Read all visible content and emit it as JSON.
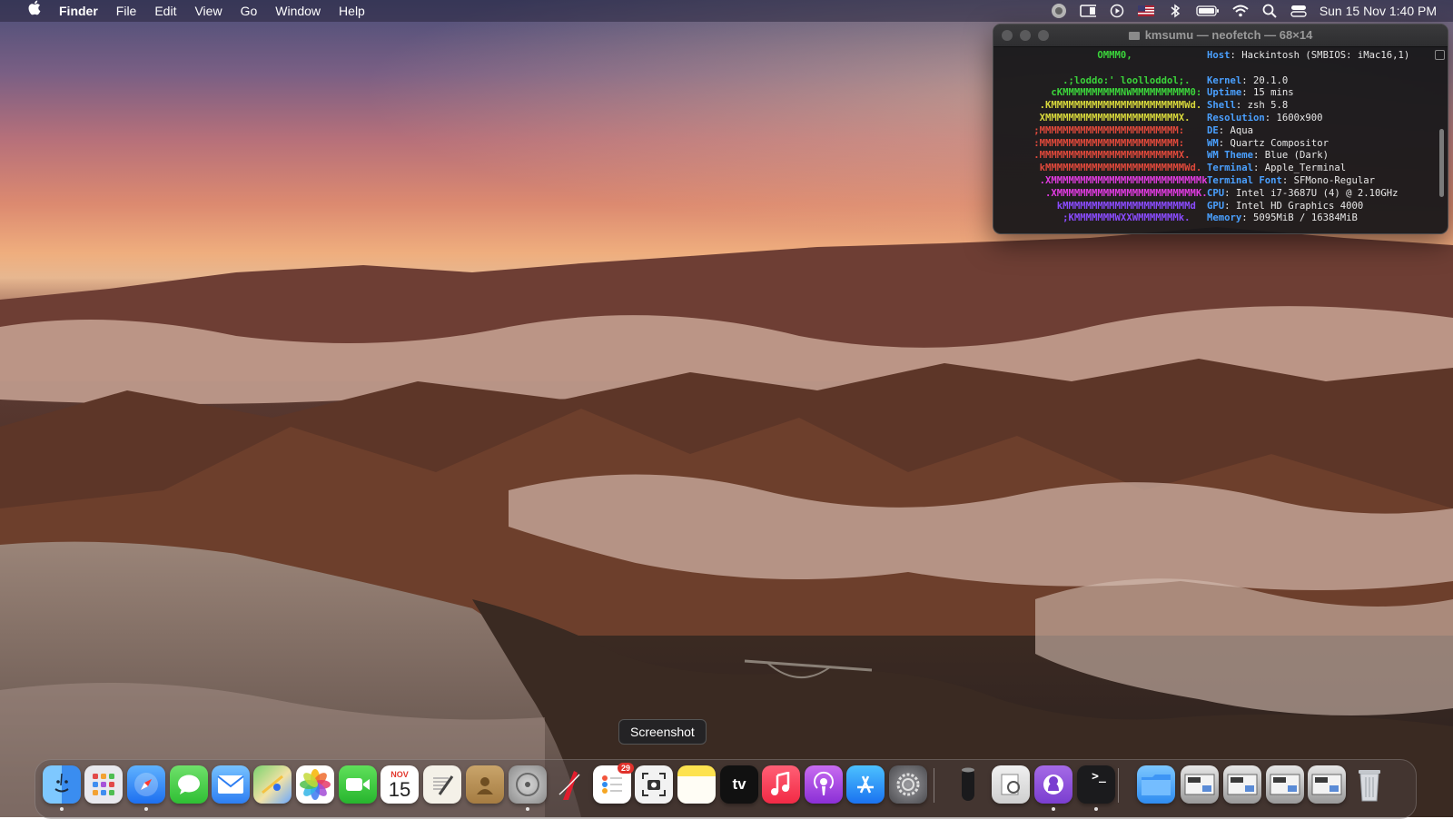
{
  "menubar": {
    "apple_icon": "apple-logo-icon",
    "app_name": "Finder",
    "menus": [
      "File",
      "Edit",
      "View",
      "Go",
      "Window",
      "Help"
    ],
    "status_icons": [
      "screen-time-icon",
      "display-icon",
      "play-icon",
      "us-flag-icon",
      "bluetooth-icon",
      "battery-icon",
      "wifi-icon",
      "spotlight-icon",
      "control-center-icon"
    ],
    "clock": "Sun 15 Nov  1:40 PM"
  },
  "terminal": {
    "title": "kmsumu — neofetch — 68×14",
    "art_lines": [
      {
        "text": "                 OMMM0,",
        "color": "#3bd43b"
      },
      {
        "text": "",
        "color": "#3bd43b"
      },
      {
        "text": "           .;loddo:' loolloddol;.",
        "color": "#3bd43b"
      },
      {
        "text": "         cKMMMMMMMMMMNWMMMMMMMMMM0:",
        "color": "#3bd43b"
      },
      {
        "text": "       .KMMMMMMMMMMMMMMMMMMMMMMMWd.",
        "color": "#d8d83c"
      },
      {
        "text": "       XMMMMMMMMMMMMMMMMMMMMMMMX.",
        "color": "#d8d83c"
      },
      {
        "text": "      ;MMMMMMMMMMMMMMMMMMMMMMMM:",
        "color": "#e0493b"
      },
      {
        "text": "      :MMMMMMMMMMMMMMMMMMMMMMMM:",
        "color": "#e0493b"
      },
      {
        "text": "      .MMMMMMMMMMMMMMMMMMMMMMMMX.",
        "color": "#e0493b"
      },
      {
        "text": "       kMMMMMMMMMMMMMMMMMMMMMMMMWd.",
        "color": "#e0493b"
      },
      {
        "text": "       .XMMMMMMMMMMMMMMMMMMMMMMMMMMk",
        "color": "#e03be0"
      },
      {
        "text": "        .XMMMMMMMMMMMMMMMMMMMMMMMMK.",
        "color": "#e03be0"
      },
      {
        "text": "          kMMMMMMMMMMMMMMMMMMMMMMd",
        "color": "#8a4bff"
      },
      {
        "text": "           ;KMMMMMMMWXXWMMMMMMMk.",
        "color": "#8a4bff"
      }
    ],
    "info": [
      {
        "key": "Host",
        "value": "Hackintosh (SMBIOS: iMac16,1)"
      },
      {
        "key": "",
        "value": ""
      },
      {
        "key": "Kernel",
        "value": "20.1.0"
      },
      {
        "key": "Uptime",
        "value": "15 mins"
      },
      {
        "key": "Shell",
        "value": "zsh 5.8"
      },
      {
        "key": "Resolution",
        "value": "1600x900"
      },
      {
        "key": "DE",
        "value": "Aqua"
      },
      {
        "key": "WM",
        "value": "Quartz Compositor"
      },
      {
        "key": "WM Theme",
        "value": "Blue (Dark)"
      },
      {
        "key": "Terminal",
        "value": "Apple_Terminal"
      },
      {
        "key": "Terminal Font",
        "value": "SFMono-Regular"
      },
      {
        "key": "CPU",
        "value": "Intel i7-3687U (4) @ 2.10GHz"
      },
      {
        "key": "GPU",
        "value": "Intel HD Graphics 4000"
      },
      {
        "key": "Memory",
        "value": "5095MiB / 16384MiB"
      }
    ]
  },
  "tooltip": {
    "text": "Screenshot"
  },
  "dock": {
    "apps": [
      {
        "name": "finder",
        "icon": "finder-icon",
        "running": true
      },
      {
        "name": "launchpad",
        "icon": "launchpad-icon",
        "running": false
      },
      {
        "name": "safari",
        "icon": "safari-icon",
        "running": true
      },
      {
        "name": "messages",
        "icon": "messages-icon",
        "running": false
      },
      {
        "name": "mail",
        "icon": "mail-icon",
        "running": false
      },
      {
        "name": "maps",
        "icon": "maps-icon",
        "running": false
      },
      {
        "name": "photos",
        "icon": "photos-icon",
        "running": false
      },
      {
        "name": "facetime",
        "icon": "facetime-icon",
        "running": false
      },
      {
        "name": "calendar",
        "icon": "calendar-icon",
        "running": false,
        "month": "NOV",
        "day": "15"
      },
      {
        "name": "textedit",
        "icon": "textedit-icon",
        "running": false
      },
      {
        "name": "contacts",
        "icon": "contacts-icon",
        "running": false
      },
      {
        "name": "disk-utility",
        "icon": "disk-utility-icon",
        "running": true
      },
      {
        "name": "pdf-tool",
        "icon": "pdf-pen-icon",
        "running": false
      },
      {
        "name": "reminders",
        "icon": "reminders-icon",
        "running": false,
        "badge": "29"
      },
      {
        "name": "screenshot",
        "icon": "screenshot-icon",
        "running": false
      },
      {
        "name": "notes",
        "icon": "notes-icon",
        "running": false
      },
      {
        "name": "apple-tv",
        "icon": "apple-tv-icon",
        "running": false,
        "label": "tv"
      },
      {
        "name": "music",
        "icon": "music-icon",
        "running": false
      },
      {
        "name": "podcasts",
        "icon": "podcasts-icon",
        "running": false
      },
      {
        "name": "app-store",
        "icon": "app-store-icon",
        "running": false
      },
      {
        "name": "system-preferences",
        "icon": "gear-icon",
        "running": false
      },
      {
        "name": "mac-pro",
        "icon": "mac-pro-icon",
        "running": false
      },
      {
        "name": "preview",
        "icon": "preview-icon",
        "running": false
      },
      {
        "name": "github-desktop",
        "icon": "github-icon",
        "running": true
      },
      {
        "name": "terminal",
        "icon": "terminal-icon",
        "running": true,
        "label": ">_"
      },
      {
        "name": "downloads-folder",
        "icon": "folder-icon",
        "running": false
      },
      {
        "name": "stack-1",
        "icon": "stack-thumbnail-icon",
        "running": false
      },
      {
        "name": "stack-2",
        "icon": "stack-thumbnail-icon",
        "running": false
      },
      {
        "name": "stack-3",
        "icon": "stack-thumbnail-icon",
        "running": false
      },
      {
        "name": "stack-4",
        "icon": "stack-thumbnail-icon",
        "running": false
      },
      {
        "name": "trash",
        "icon": "trash-icon",
        "running": false
      }
    ]
  }
}
